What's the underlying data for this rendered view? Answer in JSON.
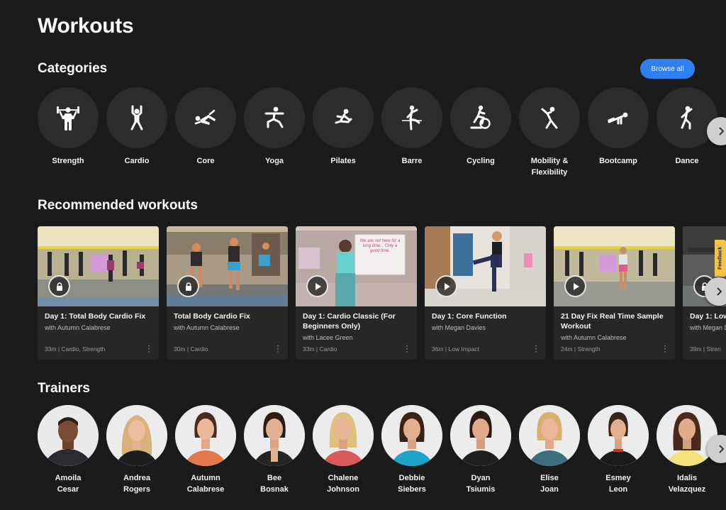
{
  "page": {
    "title": "Workouts"
  },
  "categories": {
    "heading": "Categories",
    "browse_label": "Browse all",
    "items": [
      {
        "label": "Strength",
        "icon": "strength-icon"
      },
      {
        "label": "Cardio",
        "icon": "cardio-icon"
      },
      {
        "label": "Core",
        "icon": "core-icon"
      },
      {
        "label": "Yoga",
        "icon": "yoga-icon"
      },
      {
        "label": "Pilates",
        "icon": "pilates-icon"
      },
      {
        "label": "Barre",
        "icon": "barre-icon"
      },
      {
        "label": "Cycling",
        "icon": "cycling-icon"
      },
      {
        "label": "Mobility &\nFlexibility",
        "icon": "mobility-icon"
      },
      {
        "label": "Bootcamp",
        "icon": "bootcamp-icon"
      },
      {
        "label": "Dance",
        "icon": "dance-icon"
      }
    ]
  },
  "recommended": {
    "heading": "Recommended workouts",
    "items": [
      {
        "title": "Day 1: Total Body Cardio Fix",
        "trainer": "with Autumn Calabrese",
        "meta": "33m | Cardio, Strength",
        "badge": "lock-icon"
      },
      {
        "title": "Total Body Cardio Fix",
        "trainer": "with Autumn Calabrese",
        "meta": "30m | Cardio",
        "badge": "lock-icon"
      },
      {
        "title": "Day 1: Cardio Classic (For Beginners Only)",
        "trainer": "with Lacee Green",
        "meta": "33m | Cardio",
        "badge": "play-icon"
      },
      {
        "title": "Day 1: Core Function",
        "trainer": "with Megan Davies",
        "meta": "36m | Low Impact",
        "badge": "play-icon"
      },
      {
        "title": "21 Day Fix Real Time Sample Workout",
        "trainer": "with Autumn Calabrese",
        "meta": "24m | Strength",
        "badge": "play-icon"
      },
      {
        "title": "Day 1: Low",
        "trainer": "with Megan D",
        "meta": "39m | Stren",
        "badge": "lock-icon"
      }
    ],
    "thumb_text": "We are not here for a long time... Only a good time."
  },
  "trainers": {
    "heading": "Trainers",
    "items": [
      {
        "name": "Amoila\nCesar"
      },
      {
        "name": "Andrea\nRogers"
      },
      {
        "name": "Autumn\nCalabrese"
      },
      {
        "name": "Bee\nBosnak"
      },
      {
        "name": "Chalene\nJohnson"
      },
      {
        "name": "Debbie\nSiebers"
      },
      {
        "name": "Dyan\nTsiumis"
      },
      {
        "name": "Elise\nJoan"
      },
      {
        "name": "Esmey\nLeon"
      },
      {
        "name": "Idalis\nVelazquez"
      }
    ]
  },
  "feedback_label": "Feedback",
  "colors": {
    "background": "#1b1b1c",
    "accent": "#2f80ed",
    "card": "#272729",
    "circle": "#2c2c2e"
  }
}
